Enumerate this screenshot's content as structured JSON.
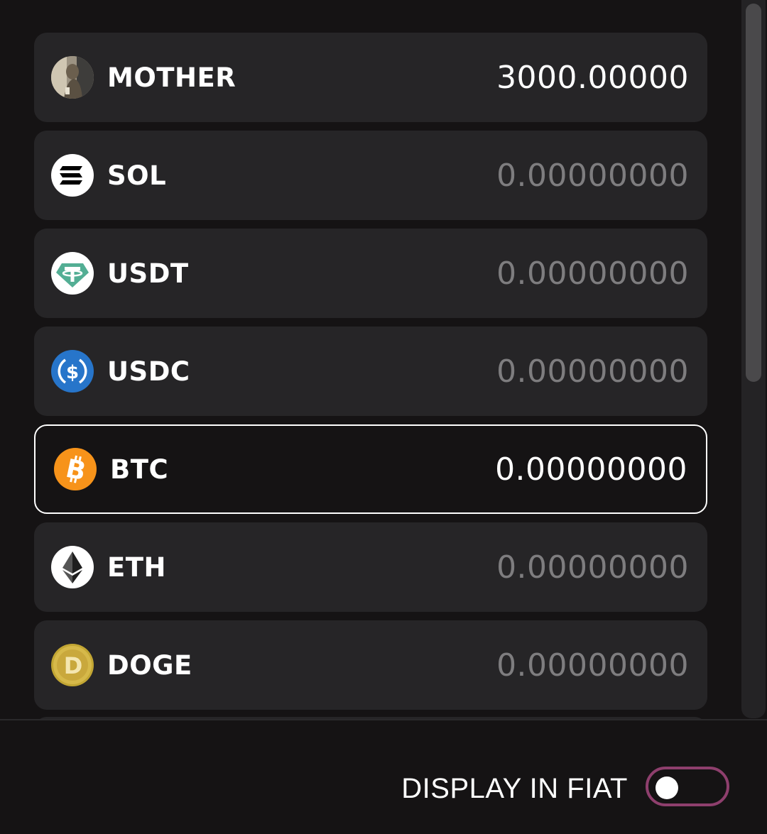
{
  "assets": [
    {
      "symbol": "MOTHER",
      "amount": "3000.00000",
      "icon": "mother-avatar-icon",
      "amount_color": "#ffffff"
    },
    {
      "symbol": "SOL",
      "amount": "0.00000000",
      "icon": "solana-icon",
      "amount_color": "#7e7d7f"
    },
    {
      "symbol": "USDT",
      "amount": "0.00000000",
      "icon": "tether-icon",
      "amount_color": "#7e7d7f"
    },
    {
      "symbol": "USDC",
      "amount": "0.00000000",
      "icon": "usdc-icon",
      "amount_color": "#7e7d7f"
    },
    {
      "symbol": "BTC",
      "amount": "0.00000000",
      "icon": "bitcoin-icon",
      "selected": true,
      "amount_color": "#ffffff"
    },
    {
      "symbol": "ETH",
      "amount": "0.00000000",
      "icon": "ethereum-icon",
      "amount_color": "#7e7d7f"
    },
    {
      "symbol": "DOGE",
      "amount": "0.00000000",
      "icon": "dogecoin-icon",
      "amount_color": "#7e7d7f"
    }
  ],
  "footer": {
    "fiat_label": "DISPLAY IN FIAT",
    "fiat_toggle_on": false
  },
  "colors": {
    "background": "#151314",
    "row": "#262527",
    "toggle_border": "#8e3f6d",
    "muted_amount": "#7e7d7f"
  }
}
